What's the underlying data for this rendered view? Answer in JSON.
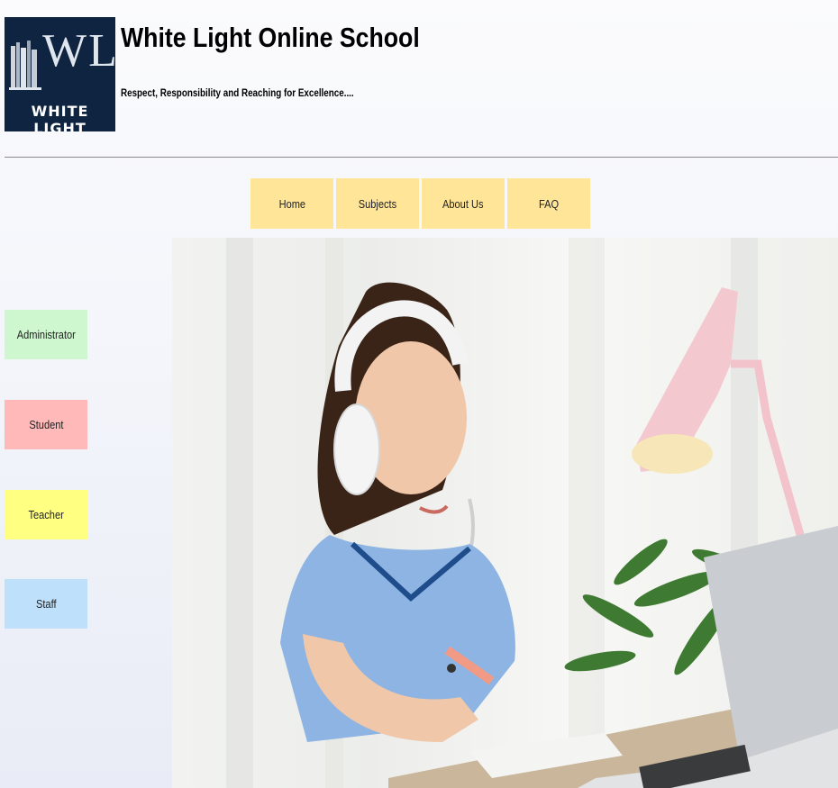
{
  "logo": {
    "monogram": "WL",
    "wordmark": "WHITE LIGHT"
  },
  "site": {
    "title": "White Light Online School",
    "tagline": "Respect, Responsibility and Reaching for Excellence...."
  },
  "nav": [
    "Home",
    "Subjects",
    "About Us",
    "FAQ"
  ],
  "sidebar": [
    "Administrator",
    "Student",
    "Teacher",
    "Staff"
  ],
  "colors": {
    "nav": "#ffe598",
    "administrator": "#cff7cf",
    "student": "#ffb9b9",
    "teacher": "#ffff82",
    "staff": "#bfe0fb",
    "logo_bg": "#0f2440"
  }
}
